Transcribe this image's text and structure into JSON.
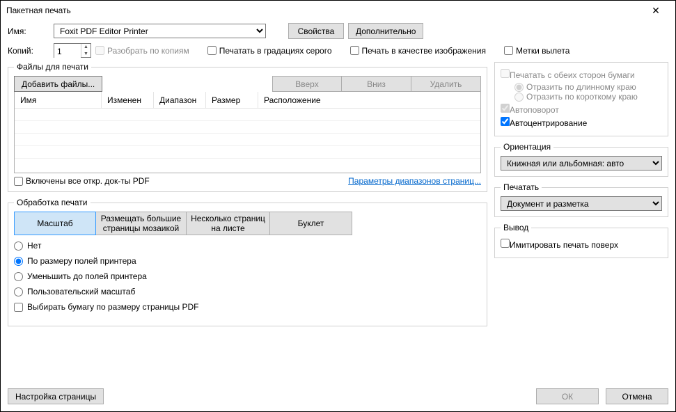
{
  "window": {
    "title": "Пакетная печать"
  },
  "top": {
    "name_label": "Имя:",
    "printer": "Foxit PDF Editor Printer",
    "properties": "Свойства",
    "advanced": "Дополнительно",
    "copies_label": "Копий:",
    "copies_value": "1",
    "collate": "Разобрать по копиям",
    "grayscale": "Печатать в градациях серого",
    "as_image": "Печать в качестве изображения",
    "bleed": "Метки вылета"
  },
  "files": {
    "legend": "Файлы для печати",
    "add": "Добавить файлы...",
    "up": "Вверх",
    "down": "Вниз",
    "delete": "Удалить",
    "cols": {
      "name": "Имя",
      "modified": "Изменен",
      "range": "Диапазон",
      "size": "Размер",
      "location": "Расположение"
    },
    "include_all": "Включены все откр. док-ты PDF",
    "range_params": "Параметры диапазонов страниц..."
  },
  "handling": {
    "legend": "Обработка печати",
    "tabs": {
      "scale": "Масштаб",
      "tile": "Размещать большие страницы мозаикой",
      "multi": "Несколько страниц на листе",
      "booklet": "Буклет"
    },
    "radios": {
      "none": "Нет",
      "fit": "По размеру полей принтера",
      "shrink": "Уменьшить до полей принтера",
      "custom": "Пользовательский масштаб"
    },
    "choose_paper": "Выбирать бумагу по размеру страницы PDF"
  },
  "right": {
    "duplex": "Печатать с обеих сторон бумаги",
    "flip_long": "Отразить по длинному краю",
    "flip_short": "Отразить по короткому краю",
    "autorotate": "Автоповорот",
    "autocenter": "Автоцентрирование",
    "orient_legend": "Ориентация",
    "orient_value": "Книжная или альбомная: авто",
    "print_legend": "Печатать",
    "print_value": "Документ и разметка",
    "output_legend": "Вывод",
    "simulate": "Имитировать печать поверх"
  },
  "footer": {
    "page_setup": "Настройка страницы",
    "ok": "ОК",
    "cancel": "Отмена"
  }
}
